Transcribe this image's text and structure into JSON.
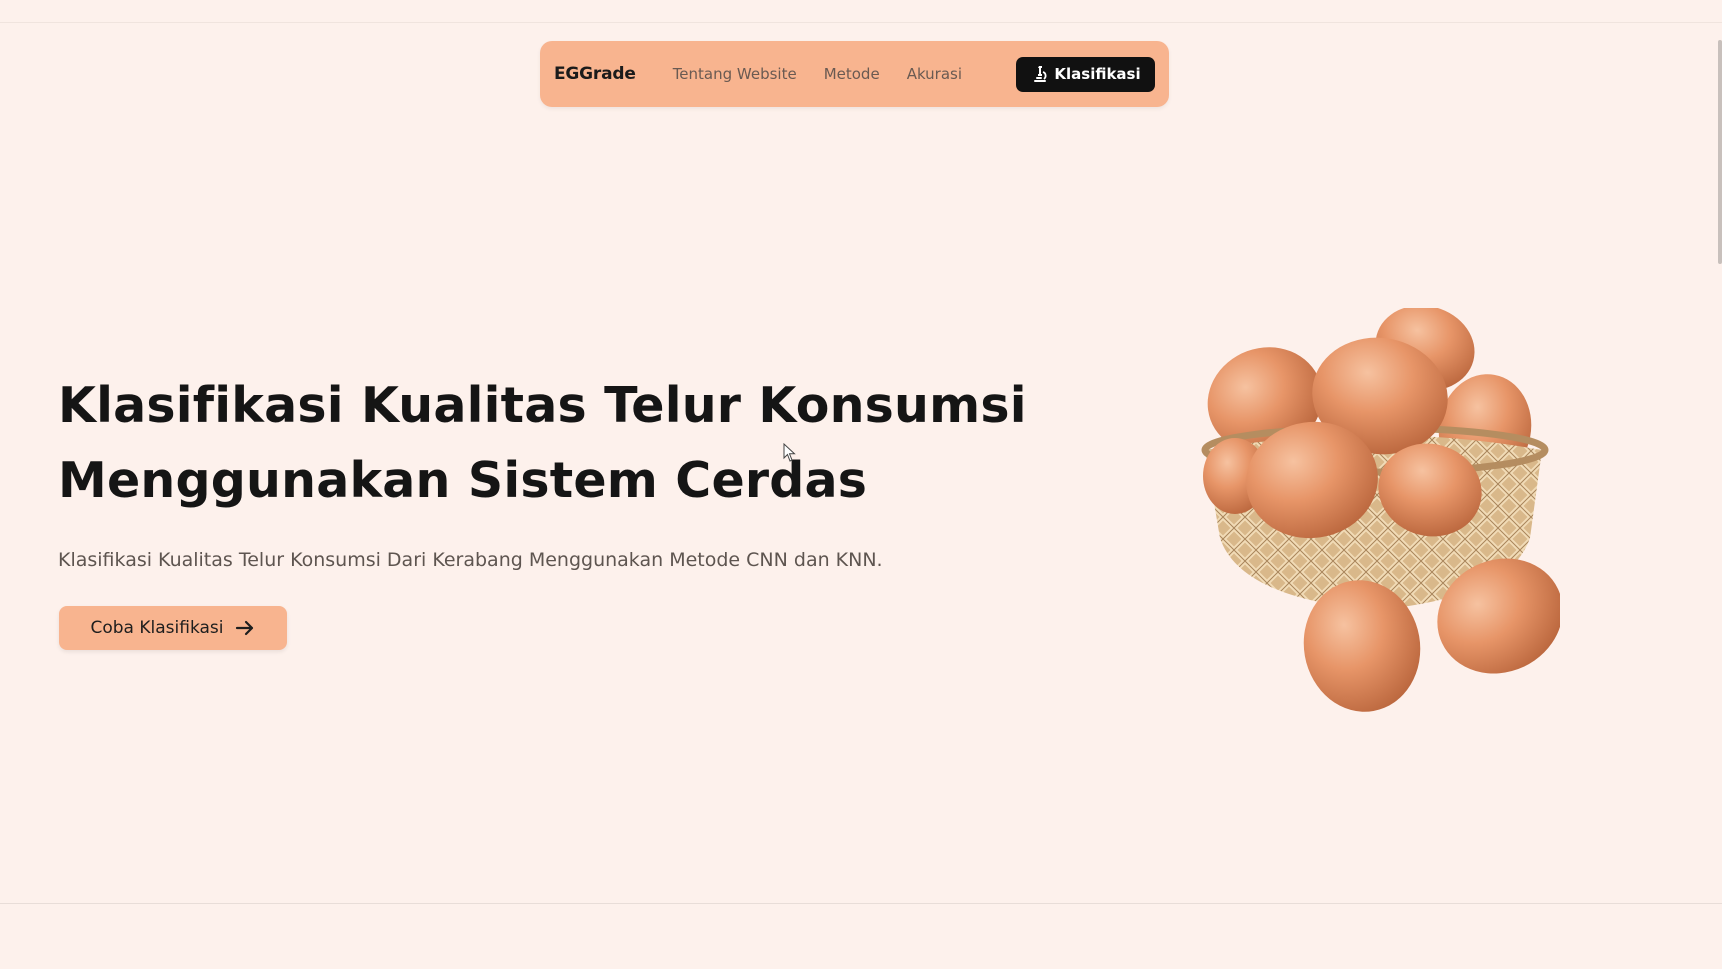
{
  "navbar": {
    "brand": "EGGrade",
    "links": [
      {
        "label": "Tentang Website"
      },
      {
        "label": "Metode"
      },
      {
        "label": "Akurasi"
      }
    ],
    "cta_label": "Klasifikasi",
    "cta_icon": "microscope-icon",
    "background_color": "#f8b48f"
  },
  "hero": {
    "title_line_1": "Klasifikasi Kualitas Telur Konsumsi",
    "title_line_2": "Menggunakan Sistem Cerdas",
    "subtitle": "Klasifikasi Kualitas Telur Konsumsi Dari Kerabang Menggunakan Metode CNN dan KNN.",
    "button_label": "Coba Klasifikasi",
    "button_icon": "arrow-right-icon",
    "illustration": "egg-basket-illustration"
  },
  "colors": {
    "page_background": "#fdf1ec",
    "accent": "#f8b48f",
    "dark": "#111111"
  }
}
